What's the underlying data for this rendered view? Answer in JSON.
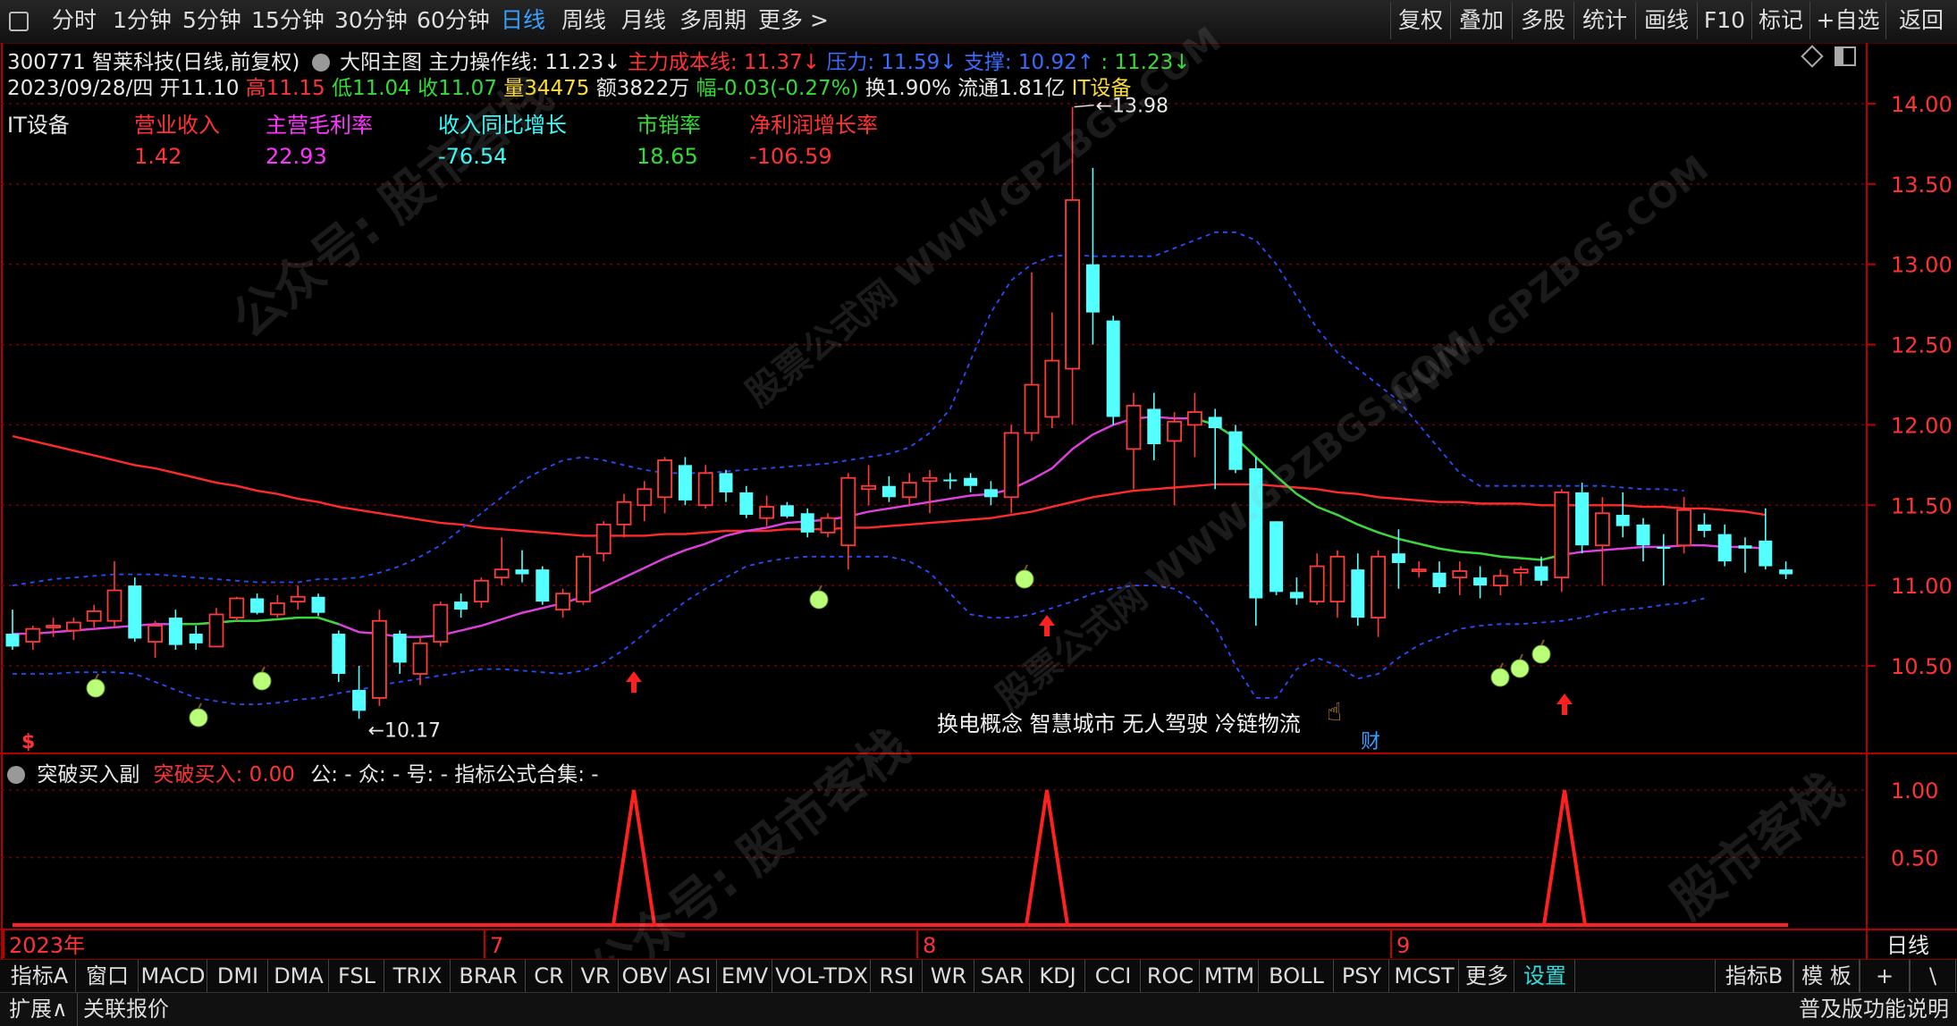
{
  "toolbar": {
    "periods": [
      "分时",
      "1分钟",
      "5分钟",
      "15分钟",
      "30分钟",
      "60分钟",
      "日线",
      "周线",
      "月线",
      "多周期",
      "更多 >"
    ],
    "active_period": "日线",
    "right_buttons": [
      "复权",
      "叠加",
      "多股",
      "统计",
      "画线",
      "F10",
      "标记",
      "+自选",
      "返回"
    ]
  },
  "stock": {
    "header": "300771 智莱科技(日线,前复权)",
    "main_indicator": "大阳主图",
    "lines": [
      {
        "label": "主力操作线: 11.23↓",
        "color": "#e8e8e8"
      },
      {
        "label": "主力成本线: 11.37↓",
        "color": "#ff3333"
      },
      {
        "label": "压力: 11.59↓",
        "color": "#3a6cff"
      },
      {
        "label": "支撑: 10.92↑",
        "color": "#3a6cff"
      },
      {
        "label": ": 11.23↓",
        "color": "#33dd33"
      }
    ],
    "quote": [
      {
        "t": "2023/09/28/四",
        "c": "#e8e8e8"
      },
      {
        "t": " 开11.10 ",
        "c": "#e8e8e8"
      },
      {
        "t": "高11.15 ",
        "c": "#ff3333"
      },
      {
        "t": "低11.04 ",
        "c": "#33dd33"
      },
      {
        "t": "收11.07 ",
        "c": "#33dd33"
      },
      {
        "t": "量34475 ",
        "c": "#ffdd33"
      },
      {
        "t": "额3822万 ",
        "c": "#e8e8e8"
      },
      {
        "t": "幅-0.03(-0.27%) ",
        "c": "#33dd33"
      },
      {
        "t": "换1.90% 流通1.81亿 ",
        "c": "#e8e8e8"
      },
      {
        "t": "IT设备",
        "c": "#ffdd33"
      }
    ]
  },
  "fundamentals": {
    "sector": "IT设备",
    "items": [
      {
        "label": "营业收入",
        "value": "1.42",
        "label_color": "#ff3333",
        "value_color": "#ff3333"
      },
      {
        "label": "主营毛利率",
        "value": "22.93",
        "label_color": "#ff33ff",
        "value_color": "#ff33ff"
      },
      {
        "label": "收入同比增长",
        "value": "-76.54",
        "label_color": "#33ffff",
        "value_color": "#33ffff"
      },
      {
        "label": "市销率",
        "value": "18.65",
        "label_color": "#33dd33",
        "value_color": "#33dd33"
      },
      {
        "label": "净利润增长率",
        "value": "-106.59",
        "label_color": "#ff3333",
        "value_color": "#ff3333"
      }
    ]
  },
  "annotations": {
    "high_label": "13.98",
    "low_label": "10.17",
    "concepts": "换电概念 智慧城市 无人驾驶 冷链物流",
    "cai_badge": "财",
    "dollar": "$"
  },
  "sub_panel": {
    "name": "突破买入副",
    "label": "突破买入: 0.00",
    "extras": "公: -  众: -  号: -  指标公式合集: -"
  },
  "chart_data": [
    {
      "type": "candlestick",
      "title": "",
      "y_axis_ticks": [
        14.0,
        13.5,
        13.0,
        12.5,
        12.0,
        11.5,
        11.0,
        10.5
      ],
      "ylim": [
        10.17,
        13.98
      ],
      "x_labels": [
        "2023年",
        "7",
        "8",
        "9"
      ],
      "candles": [
        {
          "o": 10.7,
          "h": 10.85,
          "l": 10.6,
          "c": 10.62
        },
        {
          "o": 10.65,
          "h": 10.75,
          "l": 10.6,
          "c": 10.73
        },
        {
          "o": 10.75,
          "h": 10.8,
          "l": 10.68,
          "c": 10.75
        },
        {
          "o": 10.72,
          "h": 10.8,
          "l": 10.66,
          "c": 10.77
        },
        {
          "o": 10.78,
          "h": 10.88,
          "l": 10.74,
          "c": 10.84
        },
        {
          "o": 10.78,
          "h": 11.15,
          "l": 10.74,
          "c": 10.97
        },
        {
          "o": 11.0,
          "h": 11.05,
          "l": 10.65,
          "c": 10.67
        },
        {
          "o": 10.65,
          "h": 10.78,
          "l": 10.55,
          "c": 10.75
        },
        {
          "o": 10.8,
          "h": 10.85,
          "l": 10.6,
          "c": 10.63
        },
        {
          "o": 10.7,
          "h": 10.75,
          "l": 10.6,
          "c": 10.64
        },
        {
          "o": 10.62,
          "h": 10.86,
          "l": 10.62,
          "c": 10.82
        },
        {
          "o": 10.8,
          "h": 10.93,
          "l": 10.78,
          "c": 10.92
        },
        {
          "o": 10.92,
          "h": 10.95,
          "l": 10.82,
          "c": 10.83
        },
        {
          "o": 10.82,
          "h": 10.94,
          "l": 10.8,
          "c": 10.89
        },
        {
          "o": 10.9,
          "h": 11.0,
          "l": 10.85,
          "c": 10.93
        },
        {
          "o": 10.93,
          "h": 10.95,
          "l": 10.81,
          "c": 10.83
        },
        {
          "o": 10.7,
          "h": 10.72,
          "l": 10.4,
          "c": 10.45
        },
        {
          "o": 10.35,
          "h": 10.5,
          "l": 10.17,
          "c": 10.22
        },
        {
          "o": 10.3,
          "h": 10.85,
          "l": 10.25,
          "c": 10.78
        },
        {
          "o": 10.7,
          "h": 10.72,
          "l": 10.45,
          "c": 10.52
        },
        {
          "o": 10.45,
          "h": 10.68,
          "l": 10.38,
          "c": 10.64
        },
        {
          "o": 10.65,
          "h": 10.9,
          "l": 10.62,
          "c": 10.88
        },
        {
          "o": 10.9,
          "h": 10.95,
          "l": 10.8,
          "c": 10.85
        },
        {
          "o": 10.9,
          "h": 11.05,
          "l": 10.86,
          "c": 11.03
        },
        {
          "o": 11.05,
          "h": 11.3,
          "l": 11.0,
          "c": 11.1
        },
        {
          "o": 11.1,
          "h": 11.22,
          "l": 11.02,
          "c": 11.07
        },
        {
          "o": 11.1,
          "h": 11.12,
          "l": 10.88,
          "c": 10.9
        },
        {
          "o": 10.85,
          "h": 10.98,
          "l": 10.8,
          "c": 10.95
        },
        {
          "o": 10.9,
          "h": 11.2,
          "l": 10.88,
          "c": 11.18
        },
        {
          "o": 11.2,
          "h": 11.4,
          "l": 11.15,
          "c": 11.38
        },
        {
          "o": 11.38,
          "h": 11.57,
          "l": 11.3,
          "c": 11.52
        },
        {
          "o": 11.5,
          "h": 11.65,
          "l": 11.4,
          "c": 11.6
        },
        {
          "o": 11.55,
          "h": 11.8,
          "l": 11.45,
          "c": 11.78
        },
        {
          "o": 11.75,
          "h": 11.8,
          "l": 11.5,
          "c": 11.53
        },
        {
          "o": 11.5,
          "h": 11.75,
          "l": 11.48,
          "c": 11.7
        },
        {
          "o": 11.7,
          "h": 11.72,
          "l": 11.52,
          "c": 11.58
        },
        {
          "o": 11.58,
          "h": 11.62,
          "l": 11.42,
          "c": 11.44
        },
        {
          "o": 11.42,
          "h": 11.56,
          "l": 11.37,
          "c": 11.49
        },
        {
          "o": 11.5,
          "h": 11.52,
          "l": 11.42,
          "c": 11.43
        },
        {
          "o": 11.45,
          "h": 11.48,
          "l": 11.3,
          "c": 11.33
        },
        {
          "o": 11.33,
          "h": 11.45,
          "l": 11.3,
          "c": 11.42
        },
        {
          "o": 11.25,
          "h": 11.7,
          "l": 11.1,
          "c": 11.67
        },
        {
          "o": 11.6,
          "h": 11.75,
          "l": 11.5,
          "c": 11.62
        },
        {
          "o": 11.62,
          "h": 11.68,
          "l": 11.52,
          "c": 11.55
        },
        {
          "o": 11.55,
          "h": 11.7,
          "l": 11.5,
          "c": 11.64
        },
        {
          "o": 11.65,
          "h": 11.72,
          "l": 11.45,
          "c": 11.67
        },
        {
          "o": 11.66,
          "h": 11.7,
          "l": 11.6,
          "c": 11.65
        },
        {
          "o": 11.67,
          "h": 11.7,
          "l": 11.58,
          "c": 11.62
        },
        {
          "o": 11.6,
          "h": 11.65,
          "l": 11.5,
          "c": 11.55
        },
        {
          "o": 11.55,
          "h": 12.0,
          "l": 11.45,
          "c": 11.95
        },
        {
          "o": 11.95,
          "h": 12.95,
          "l": 11.9,
          "c": 12.25
        },
        {
          "o": 12.05,
          "h": 12.7,
          "l": 11.98,
          "c": 12.4
        },
        {
          "o": 12.35,
          "h": 13.98,
          "l": 12.0,
          "c": 13.4
        },
        {
          "o": 13.0,
          "h": 13.6,
          "l": 12.5,
          "c": 12.7
        },
        {
          "o": 12.65,
          "h": 12.68,
          "l": 12.0,
          "c": 12.05
        },
        {
          "o": 11.85,
          "h": 12.2,
          "l": 11.6,
          "c": 12.12
        },
        {
          "o": 12.1,
          "h": 12.2,
          "l": 11.78,
          "c": 11.88
        },
        {
          "o": 11.9,
          "h": 12.08,
          "l": 11.5,
          "c": 12.02
        },
        {
          "o": 12.0,
          "h": 12.2,
          "l": 11.8,
          "c": 12.08
        },
        {
          "o": 12.05,
          "h": 12.1,
          "l": 11.6,
          "c": 11.98
        },
        {
          "o": 11.96,
          "h": 12.0,
          "l": 11.7,
          "c": 11.72
        },
        {
          "o": 11.73,
          "h": 11.8,
          "l": 10.75,
          "c": 10.92
        },
        {
          "o": 11.4,
          "h": 11.4,
          "l": 10.94,
          "c": 10.96
        },
        {
          "o": 10.96,
          "h": 11.05,
          "l": 10.88,
          "c": 10.92
        },
        {
          "o": 10.9,
          "h": 11.2,
          "l": 10.88,
          "c": 11.12
        },
        {
          "o": 10.9,
          "h": 11.22,
          "l": 10.8,
          "c": 11.18
        },
        {
          "o": 11.1,
          "h": 11.2,
          "l": 10.75,
          "c": 10.8
        },
        {
          "o": 10.8,
          "h": 11.22,
          "l": 10.68,
          "c": 11.18
        },
        {
          "o": 11.2,
          "h": 11.35,
          "l": 10.98,
          "c": 11.14
        },
        {
          "o": 11.1,
          "h": 11.15,
          "l": 11.05,
          "c": 11.1
        },
        {
          "o": 11.08,
          "h": 11.15,
          "l": 10.95,
          "c": 10.99
        },
        {
          "o": 11.05,
          "h": 11.15,
          "l": 10.94,
          "c": 11.09
        },
        {
          "o": 11.05,
          "h": 11.12,
          "l": 10.92,
          "c": 11.0
        },
        {
          "o": 11.0,
          "h": 11.1,
          "l": 10.94,
          "c": 11.06
        },
        {
          "o": 11.08,
          "h": 11.12,
          "l": 11.0,
          "c": 11.1
        },
        {
          "o": 11.12,
          "h": 11.18,
          "l": 11.0,
          "c": 11.03
        },
        {
          "o": 11.05,
          "h": 11.6,
          "l": 10.96,
          "c": 11.58
        },
        {
          "o": 11.58,
          "h": 11.64,
          "l": 11.2,
          "c": 11.25
        },
        {
          "o": 11.25,
          "h": 11.55,
          "l": 11.0,
          "c": 11.45
        },
        {
          "o": 11.44,
          "h": 11.58,
          "l": 11.3,
          "c": 11.37
        },
        {
          "o": 11.38,
          "h": 11.42,
          "l": 11.15,
          "c": 11.25
        },
        {
          "o": 11.24,
          "h": 11.32,
          "l": 11.0,
          "c": 11.23
        },
        {
          "o": 11.25,
          "h": 11.55,
          "l": 11.2,
          "c": 11.47
        },
        {
          "o": 11.38,
          "h": 11.45,
          "l": 11.3,
          "c": 11.34
        },
        {
          "o": 11.32,
          "h": 11.38,
          "l": 11.12,
          "c": 11.15
        },
        {
          "o": 11.25,
          "h": 11.3,
          "l": 11.08,
          "c": 11.23
        },
        {
          "o": 11.28,
          "h": 11.48,
          "l": 11.1,
          "c": 11.12
        },
        {
          "o": 11.1,
          "h": 11.15,
          "l": 11.04,
          "c": 11.07
        }
      ],
      "series": [
        {
          "name": "主力成本线",
          "color": "#ff2a2a",
          "values": [
            11.93,
            11.9,
            11.87,
            11.84,
            11.81,
            11.78,
            11.75,
            11.73,
            11.7,
            11.67,
            11.64,
            11.62,
            11.59,
            11.57,
            11.54,
            11.52,
            11.49,
            11.47,
            11.45,
            11.43,
            11.41,
            11.39,
            11.38,
            11.36,
            11.35,
            11.34,
            11.33,
            11.32,
            11.31,
            11.31,
            11.31,
            11.31,
            11.32,
            11.32,
            11.33,
            11.34,
            11.34,
            11.34,
            11.35,
            11.35,
            11.35,
            11.36,
            11.36,
            11.37,
            11.38,
            11.39,
            11.4,
            11.41,
            11.42,
            11.44,
            11.46,
            11.49,
            11.52,
            11.55,
            11.57,
            11.59,
            11.6,
            11.61,
            11.62,
            11.63,
            11.63,
            11.63,
            11.62,
            11.61,
            11.6,
            11.58,
            11.57,
            11.55,
            11.54,
            11.53,
            11.52,
            11.52,
            11.51,
            11.51,
            11.51,
            11.5,
            11.5,
            11.5,
            11.5,
            11.5,
            11.49,
            11.49,
            11.48,
            11.48,
            11.47,
            11.46,
            11.44
          ]
        },
        {
          "name": "主力操作线",
          "color": "#e040e0",
          "values": [
            10.7,
            10.7,
            10.71,
            10.72,
            10.73,
            10.74,
            10.75,
            10.76,
            10.76,
            10.76,
            10.77,
            10.78,
            10.78,
            10.79,
            10.8,
            10.8,
            10.76,
            10.71,
            10.7,
            10.68,
            10.68,
            10.69,
            10.72,
            10.75,
            10.79,
            10.83,
            10.86,
            10.89,
            10.93,
            10.99,
            11.05,
            11.11,
            11.17,
            11.22,
            11.26,
            11.31,
            11.34,
            11.36,
            11.39,
            11.4,
            11.41,
            11.43,
            11.46,
            11.48,
            11.5,
            11.52,
            11.54,
            11.56,
            11.57,
            11.6,
            11.66,
            11.73,
            11.85,
            11.94,
            12.0,
            12.04,
            12.05,
            12.04,
            12.04,
            12.0,
            11.92,
            11.8,
            11.68,
            11.57,
            11.49,
            11.44,
            11.38,
            11.33,
            11.29,
            11.26,
            11.23,
            11.21,
            11.2,
            11.18,
            11.17,
            11.16,
            11.19,
            11.21,
            11.22,
            11.23,
            11.24,
            11.24,
            11.25,
            11.25,
            11.24,
            11.24,
            11.23
          ]
        },
        {
          "name": "压力",
          "color": "#2a4cff",
          "values": [
            11.0,
            11.02,
            11.04,
            11.05,
            11.06,
            11.07,
            11.07,
            11.07,
            11.06,
            11.05,
            11.04,
            11.03,
            11.02,
            11.02,
            11.02,
            11.04,
            11.04,
            11.05,
            11.08,
            11.12,
            11.18,
            11.25,
            11.35,
            11.45,
            11.55,
            11.65,
            11.72,
            11.78,
            11.8,
            11.78,
            11.75,
            11.72,
            11.7,
            11.7,
            11.7,
            11.71,
            11.72,
            11.73,
            11.74,
            11.75,
            11.76,
            11.78,
            11.8,
            11.82,
            11.86,
            11.95,
            12.1,
            12.4,
            12.7,
            12.9,
            13.0,
            13.05,
            13.06,
            13.05,
            13.05,
            13.05,
            13.05,
            13.1,
            13.15,
            13.2,
            13.2,
            13.15,
            13.0,
            12.8,
            12.6,
            12.45,
            12.35,
            12.25,
            12.15,
            12.0,
            11.85,
            11.7,
            11.62,
            11.62,
            11.62,
            11.62,
            11.62,
            11.62,
            11.62,
            11.61,
            11.6,
            11.6,
            11.59
          ]
        },
        {
          "name": "支撑",
          "color": "#2a4cff",
          "values": [
            10.45,
            10.45,
            10.45,
            10.46,
            10.46,
            10.46,
            10.45,
            10.4,
            10.35,
            10.3,
            10.28,
            10.26,
            10.26,
            10.27,
            10.29,
            10.3,
            10.33,
            10.35,
            10.38,
            10.4,
            10.42,
            10.44,
            10.46,
            10.48,
            10.48,
            10.47,
            10.46,
            10.45,
            10.47,
            10.52,
            10.6,
            10.7,
            10.8,
            10.9,
            10.98,
            11.05,
            11.12,
            11.15,
            11.17,
            11.18,
            11.18,
            11.18,
            11.18,
            11.18,
            11.15,
            11.08,
            10.95,
            10.82,
            10.8,
            10.8,
            10.82,
            10.86,
            10.9,
            10.95,
            10.98,
            11.0,
            11.0,
            10.98,
            10.9,
            10.75,
            10.5,
            10.3,
            10.3,
            10.48,
            10.55,
            10.5,
            10.42,
            10.45,
            10.55,
            10.63,
            10.68,
            10.73,
            10.75,
            10.76,
            10.76,
            10.77,
            10.78,
            10.8,
            10.83,
            10.85,
            10.86,
            10.88,
            10.89,
            10.92
          ]
        }
      ],
      "buy_arrows_at": [
        36,
        59,
        88
      ]
    },
    {
      "type": "line",
      "name": "突破买入",
      "y_axis_ticks": [
        1.0,
        0.5
      ],
      "ylim": [
        0,
        1
      ],
      "spikes_at": [
        36,
        59,
        88
      ]
    }
  ],
  "bottom_tabs": [
    "指标A",
    "窗口",
    "MACD",
    "DMI",
    "DMA",
    "FSL",
    "TRIX",
    "BRAR",
    "CR",
    "VR",
    "OBV",
    "ASI",
    "EMV",
    "VOL-TDX",
    "RSI",
    "WR",
    "SAR",
    "KDJ",
    "CCI",
    "ROC",
    "MTM",
    "BOLL",
    "PSY",
    "MCST",
    "更多",
    "设置"
  ],
  "right_tabs": [
    "指标B",
    "模 板",
    "+",
    "\\"
  ],
  "status": {
    "expand": "扩展∧",
    "related": "关联报价",
    "version": "普及版功能说明"
  },
  "axis_period_label": "日线"
}
